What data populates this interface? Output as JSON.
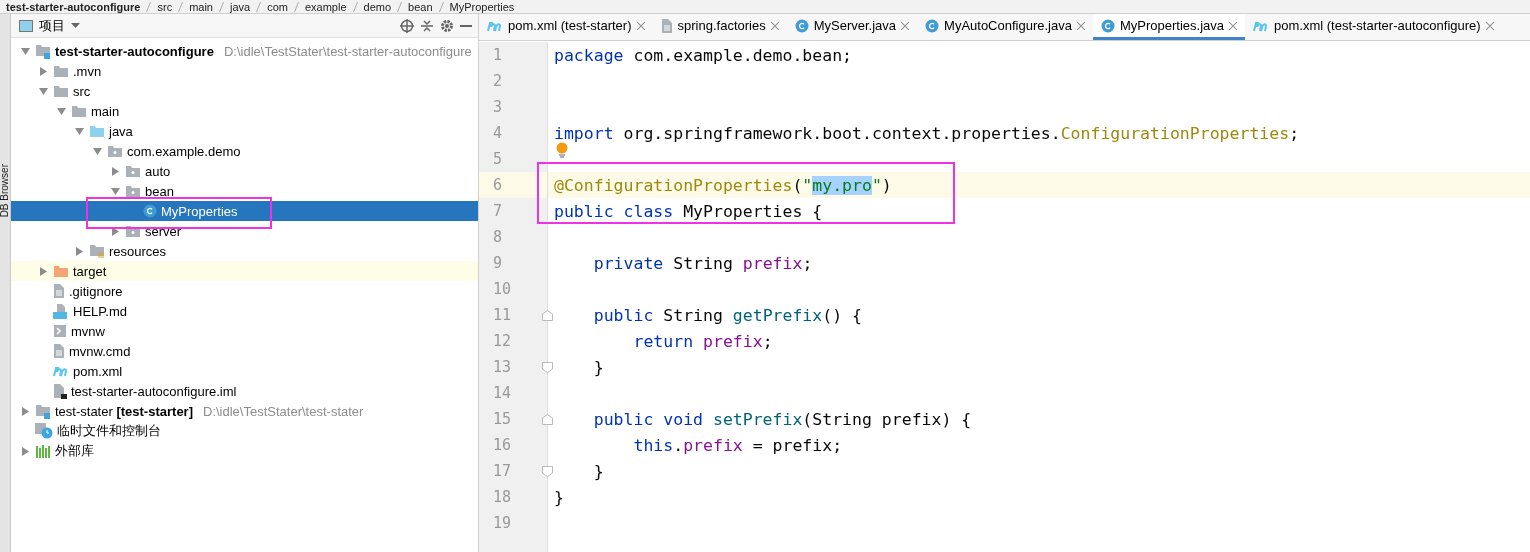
{
  "breadcrumb": [
    "test-starter-autoconfigure",
    "src",
    "main",
    "java",
    "com",
    "example",
    "demo",
    "bean",
    "MyProperties"
  ],
  "tool_strip": {
    "label": "DB Browser"
  },
  "project_panel": {
    "title": "项目",
    "tree": [
      {
        "label": "test-starter-autoconfigure",
        "kind": "module",
        "bold": true,
        "path": "D:\\idle\\TestStater\\test-starter-autoconfigure",
        "expanded": true,
        "selected": false,
        "children": [
          {
            "label": ".mvn",
            "kind": "folder",
            "expanded": false,
            "selected": false
          },
          {
            "label": "src",
            "kind": "folder",
            "expanded": true,
            "selected": false,
            "children": [
              {
                "label": "main",
                "kind": "folder",
                "expanded": true,
                "selected": false,
                "children": [
                  {
                    "label": "java",
                    "kind": "source",
                    "expanded": true,
                    "selected": false,
                    "children": [
                      {
                        "label": "com.example.demo",
                        "kind": "package",
                        "expanded": true,
                        "selected": false,
                        "children": [
                          {
                            "label": "auto",
                            "kind": "package",
                            "expanded": false,
                            "selected": false
                          },
                          {
                            "label": "bean",
                            "kind": "package",
                            "expanded": true,
                            "selected": false,
                            "children": [
                              {
                                "label": "MyProperties",
                                "kind": "class",
                                "selected": true
                              }
                            ]
                          },
                          {
                            "label": "server",
                            "kind": "package",
                            "expanded": false,
                            "selected": false
                          }
                        ]
                      }
                    ]
                  },
                  {
                    "label": "resources",
                    "kind": "resources",
                    "expanded": false,
                    "selected": false
                  }
                ]
              }
            ]
          },
          {
            "label": "target",
            "kind": "excluded",
            "expanded": false,
            "selected": false
          },
          {
            "label": ".gitignore",
            "kind": "text",
            "selected": false
          },
          {
            "label": "HELP.md",
            "kind": "markdown",
            "selected": false
          },
          {
            "label": "mvnw",
            "kind": "script",
            "selected": false
          },
          {
            "label": "mvnw.cmd",
            "kind": "text",
            "selected": false
          },
          {
            "label": "pom.xml",
            "kind": "maven",
            "selected": false
          },
          {
            "label": "test-starter-autoconfigure.iml",
            "kind": "iml",
            "selected": false
          }
        ]
      },
      {
        "label": "test-stater **[test-starter]**",
        "kind": "module",
        "bold": false,
        "path": "D:\\idle\\TestStater\\test-stater",
        "expanded": false,
        "selected": false
      },
      {
        "label": "临时文件和控制台",
        "kind": "scratch",
        "selected": false
      },
      {
        "label": "外部库",
        "kind": "library",
        "expanded": false,
        "selected": false
      }
    ]
  },
  "tabs": [
    {
      "label": "pom.xml (test-starter)",
      "kind": "maven",
      "selected": false
    },
    {
      "label": "spring.factories",
      "kind": "text",
      "selected": false
    },
    {
      "label": "MyServer.java",
      "kind": "class",
      "selected": false
    },
    {
      "label": "MyAutoConfigure.java",
      "kind": "class",
      "selected": false
    },
    {
      "label": "MyProperties.java",
      "kind": "class",
      "selected": true
    },
    {
      "label": "pom.xml (test-starter-autoconfigure)",
      "kind": "maven",
      "selected": false
    }
  ],
  "editor": {
    "lines": [
      {
        "number": "1",
        "current": false,
        "tokens": [
          {
            "text": "package",
            "kind": "kw"
          },
          {
            "text": " com.example.demo.bean;",
            "kind": "plain"
          }
        ]
      },
      {
        "number": "2",
        "current": false
      },
      {
        "number": "3",
        "current": false
      },
      {
        "number": "4",
        "current": false,
        "tokens": [
          {
            "text": "import",
            "kind": "kw"
          },
          {
            "text": " org.springframework.boot.context.properties.",
            "kind": "plain"
          },
          {
            "text": "ConfigurationProperties",
            "kind": "ann"
          },
          {
            "text": ";",
            "kind": "plain"
          }
        ]
      },
      {
        "number": "5",
        "current": false,
        "bulb": true
      },
      {
        "number": "6",
        "current": true,
        "tokens": [
          {
            "text": "@ConfigurationProperties",
            "kind": "ann"
          },
          {
            "text": "(",
            "kind": "plain"
          },
          {
            "text": "\"",
            "kind": "str"
          },
          {
            "text": "my.pro",
            "kind": "str-selected"
          },
          {
            "text": "\"",
            "kind": "str"
          },
          {
            "text": ")",
            "kind": "plain"
          }
        ]
      },
      {
        "number": "7",
        "current": false,
        "tokens": [
          {
            "text": "public class",
            "kind": "kw"
          },
          {
            "text": " MyProperties {",
            "kind": "plain"
          }
        ]
      },
      {
        "number": "8",
        "current": false
      },
      {
        "number": "9",
        "current": false,
        "tokens": [
          {
            "text": "    private",
            "kind": "kw"
          },
          {
            "text": " String ",
            "kind": "plain"
          },
          {
            "text": "prefix",
            "kind": "field"
          },
          {
            "text": ";",
            "kind": "plain"
          }
        ]
      },
      {
        "number": "10",
        "current": false
      },
      {
        "number": "11",
        "current": false,
        "fold_start": true,
        "tokens": [
          {
            "text": "    public",
            "kind": "kw"
          },
          {
            "text": " String ",
            "kind": "plain"
          },
          {
            "text": "getPrefix",
            "kind": "method"
          },
          {
            "text": "() {",
            "kind": "plain"
          }
        ]
      },
      {
        "number": "12",
        "current": false,
        "tokens": [
          {
            "text": "        return ",
            "kind": "kw"
          },
          {
            "text": "prefix",
            "kind": "field"
          },
          {
            "text": ";",
            "kind": "plain"
          }
        ]
      },
      {
        "number": "13",
        "current": false,
        "fold_end": true,
        "tokens": [
          {
            "text": "    }",
            "kind": "plain"
          }
        ]
      },
      {
        "number": "14",
        "current": false
      },
      {
        "number": "15",
        "current": false,
        "fold_start": true,
        "tokens": [
          {
            "text": "    public void ",
            "kind": "kw"
          },
          {
            "text": "setPrefix",
            "kind": "method"
          },
          {
            "text": "(String prefix) {",
            "kind": "plain"
          }
        ]
      },
      {
        "number": "16",
        "current": false,
        "tokens": [
          {
            "text": "        this",
            "kind": "kw"
          },
          {
            "text": ".",
            "kind": "plain"
          },
          {
            "text": "prefix",
            "kind": "field"
          },
          {
            "text": " = prefix;",
            "kind": "plain"
          }
        ]
      },
      {
        "number": "17",
        "current": false,
        "fold_end": true,
        "tokens": [
          {
            "text": "    }",
            "kind": "plain"
          }
        ]
      },
      {
        "number": "18",
        "current": false,
        "tokens": [
          {
            "text": "}",
            "kind": "plain"
          }
        ]
      },
      {
        "number": "19",
        "current": false
      }
    ]
  }
}
